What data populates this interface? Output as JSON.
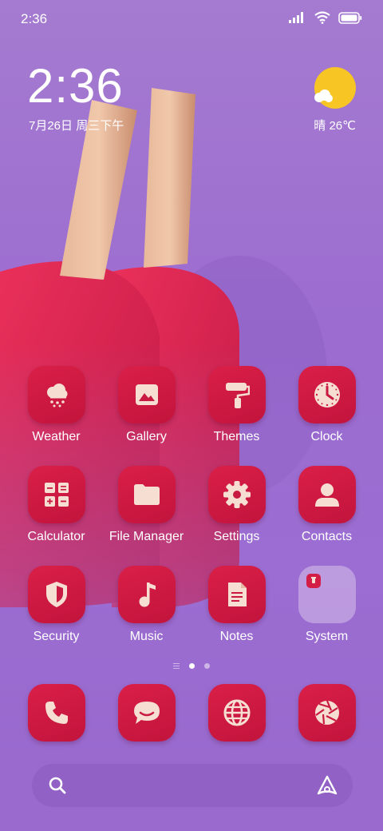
{
  "status": {
    "time": "2:36"
  },
  "clock_widget": {
    "time": "2:36",
    "date": "7月26日 周三下午"
  },
  "weather_widget": {
    "condition_temp": "晴 26℃"
  },
  "apps": [
    {
      "label": "Weather",
      "icon": "weather-icon"
    },
    {
      "label": "Gallery",
      "icon": "gallery-icon"
    },
    {
      "label": "Themes",
      "icon": "themes-icon"
    },
    {
      "label": "Clock",
      "icon": "clock-icon"
    },
    {
      "label": "Calculator",
      "icon": "calculator-icon"
    },
    {
      "label": "File Manager",
      "icon": "folder-icon"
    },
    {
      "label": "Settings",
      "icon": "gear-icon"
    },
    {
      "label": "Contacts",
      "icon": "contacts-icon"
    },
    {
      "label": "Security",
      "icon": "shield-icon"
    },
    {
      "label": "Music",
      "icon": "music-icon"
    },
    {
      "label": "Notes",
      "icon": "notes-icon"
    },
    {
      "label": "System",
      "icon": "folder-group-icon"
    }
  ],
  "dock": [
    {
      "icon": "phone-icon"
    },
    {
      "icon": "messages-icon"
    },
    {
      "icon": "browser-icon"
    },
    {
      "icon": "camera-icon"
    }
  ],
  "colors": {
    "icon_red": "#d31c46",
    "sun": "#f7c624",
    "background": "#9c6cd0"
  }
}
